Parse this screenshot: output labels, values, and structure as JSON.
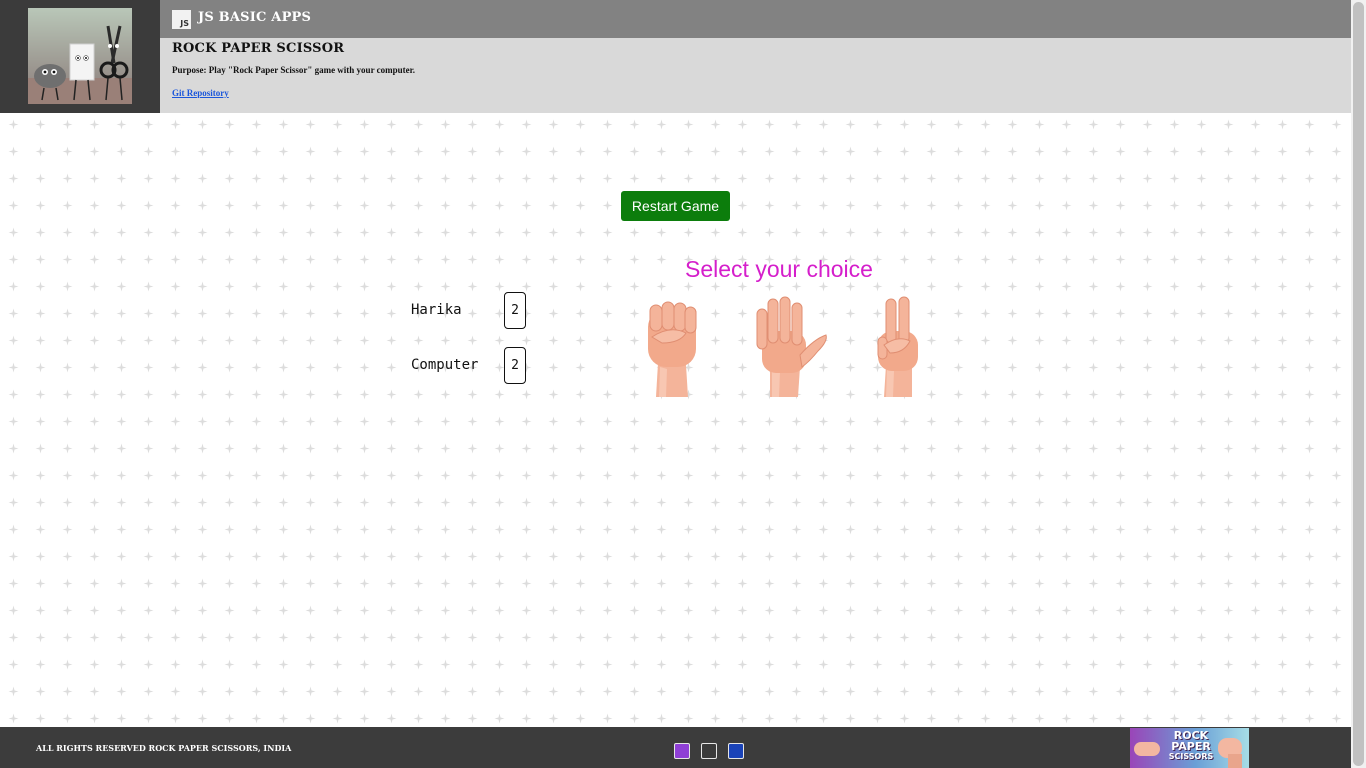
{
  "header": {
    "logo_text": "JS",
    "app_name": "JS BASIC APPS",
    "title": "ROCK PAPER SCISSOR",
    "purpose": "Purpose: Play \"Rock Paper Scissor\" game with your computer.",
    "git_link": "Git Repository"
  },
  "game": {
    "restart_label": "Restart Game",
    "choose_title": "Select your choice",
    "players": [
      {
        "name": "Harika",
        "score": "2"
      },
      {
        "name": "Computer",
        "score": "2"
      }
    ],
    "choices": [
      "rock-hand-icon",
      "paper-hand-icon",
      "scissor-hand-icon"
    ]
  },
  "footer": {
    "copyright": "ALL RIGHTS RESERVED ROCK PAPER SCISSORS, INDIA",
    "theme_colors": [
      "#8f3fd6",
      "#3a3a3a",
      "#1a43b8"
    ],
    "logo_text_lines": [
      "ROCK",
      "PAPER",
      "SCISSORS"
    ]
  },
  "colors": {
    "restart_button": "#0c7d0c",
    "choose_title": "#d51ecb",
    "header_bar": "#828282",
    "header_panel": "#d9d9d9",
    "footer": "#3c3c3c"
  }
}
